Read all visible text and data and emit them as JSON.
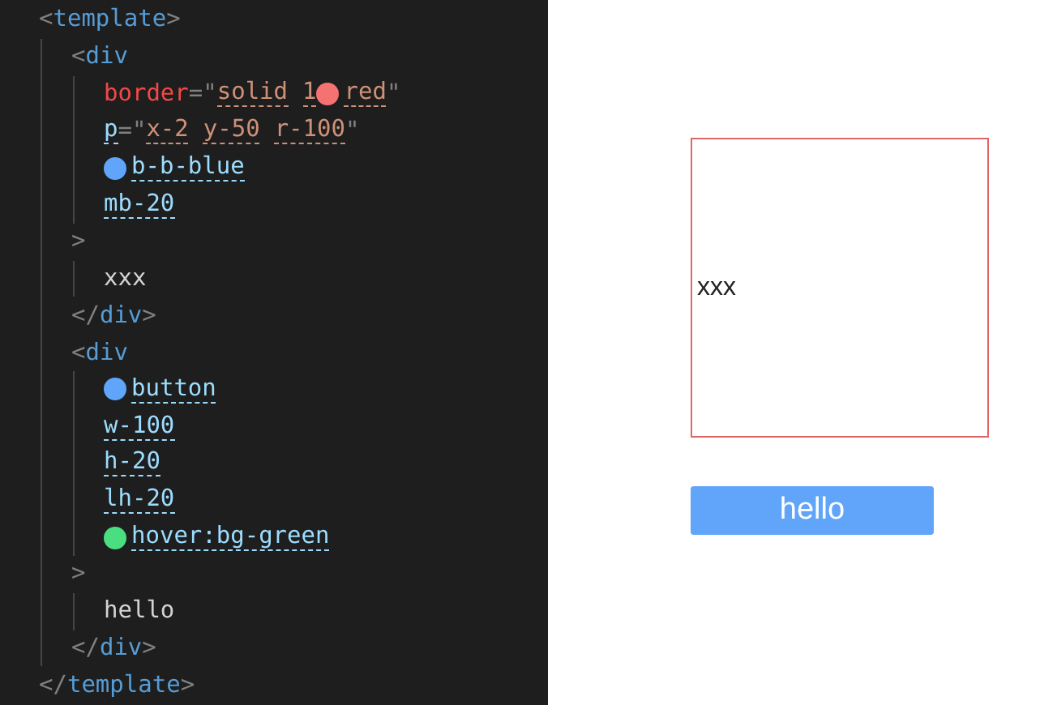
{
  "code": [
    {
      "kind": "element",
      "open": [
        {
          "kind": "punct",
          "text": "<"
        },
        {
          "kind": "tag",
          "text": "template"
        },
        {
          "kind": "punct",
          "text": ">"
        }
      ],
      "children": [
        {
          "kind": "element",
          "open": [
            {
              "kind": "punct",
              "text": "<"
            },
            {
              "kind": "tag",
              "text": "div"
            }
          ],
          "attrs": [
            [
              {
                "kind": "attr",
                "text": "border"
              },
              {
                "kind": "punct",
                "text": "=\""
              },
              {
                "kind": "value",
                "text": "solid"
              },
              {
                "kind": "value",
                "text": "1"
              },
              {
                "kind": "swatch",
                "color": "#f47272"
              },
              {
                "kind": "value",
                "text": "red"
              },
              {
                "kind": "punct",
                "text": "\""
              }
            ],
            [
              {
                "kind": "class",
                "text": "p"
              },
              {
                "kind": "punct",
                "text": "=\""
              },
              {
                "kind": "value",
                "text": "x-2"
              },
              {
                "kind": "value",
                "text": "y-50"
              },
              {
                "kind": "value",
                "text": "r-100"
              },
              {
                "kind": "punct",
                "text": "\""
              }
            ],
            [
              {
                "kind": "swatch",
                "color": "#60a5fa"
              },
              {
                "kind": "class",
                "text": "b-b-blue"
              }
            ],
            [
              {
                "kind": "class",
                "text": "mb-20"
              }
            ]
          ],
          "gt": [
            {
              "kind": "punct",
              "text": ">"
            }
          ],
          "children": [
            {
              "kind": "text",
              "text": "xxx"
            }
          ],
          "close": [
            {
              "kind": "punct",
              "text": "</"
            },
            {
              "kind": "tag",
              "text": "div"
            },
            {
              "kind": "punct",
              "text": ">"
            }
          ]
        },
        {
          "kind": "element",
          "open": [
            {
              "kind": "punct",
              "text": "<"
            },
            {
              "kind": "tag",
              "text": "div"
            }
          ],
          "attrs": [
            [
              {
                "kind": "swatch",
                "color": "#60a5fa"
              },
              {
                "kind": "class",
                "text": "button"
              }
            ],
            [
              {
                "kind": "class",
                "text": "w-100"
              }
            ],
            [
              {
                "kind": "class",
                "text": "h-20"
              }
            ],
            [
              {
                "kind": "class",
                "text": "lh-20"
              }
            ],
            [
              {
                "kind": "swatch",
                "color": "#4ade80"
              },
              {
                "kind": "class",
                "text": "hover:bg-green"
              }
            ]
          ],
          "gt": [
            {
              "kind": "punct",
              "text": ">"
            }
          ],
          "children": [
            {
              "kind": "text",
              "text": "hello"
            }
          ],
          "close": [
            {
              "kind": "punct",
              "text": "</"
            },
            {
              "kind": "tag",
              "text": "div"
            },
            {
              "kind": "punct",
              "text": ">"
            }
          ]
        }
      ],
      "close": [
        {
          "kind": "punct",
          "text": "</"
        },
        {
          "kind": "tag",
          "text": "template"
        },
        {
          "kind": "punct",
          "text": ">"
        }
      ]
    }
  ],
  "preview": {
    "box": {
      "text": "xxx"
    },
    "button": {
      "label": "hello"
    }
  }
}
